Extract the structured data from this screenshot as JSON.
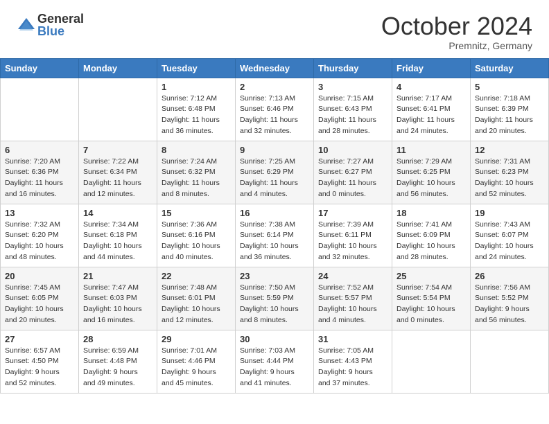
{
  "header": {
    "logo_general": "General",
    "logo_blue": "Blue",
    "month": "October 2024",
    "location": "Premnitz, Germany"
  },
  "days_of_week": [
    "Sunday",
    "Monday",
    "Tuesday",
    "Wednesday",
    "Thursday",
    "Friday",
    "Saturday"
  ],
  "weeks": [
    [
      {
        "day": "",
        "info": ""
      },
      {
        "day": "",
        "info": ""
      },
      {
        "day": "1",
        "info": "Sunrise: 7:12 AM\nSunset: 6:48 PM\nDaylight: 11 hours\nand 36 minutes."
      },
      {
        "day": "2",
        "info": "Sunrise: 7:13 AM\nSunset: 6:46 PM\nDaylight: 11 hours\nand 32 minutes."
      },
      {
        "day": "3",
        "info": "Sunrise: 7:15 AM\nSunset: 6:43 PM\nDaylight: 11 hours\nand 28 minutes."
      },
      {
        "day": "4",
        "info": "Sunrise: 7:17 AM\nSunset: 6:41 PM\nDaylight: 11 hours\nand 24 minutes."
      },
      {
        "day": "5",
        "info": "Sunrise: 7:18 AM\nSunset: 6:39 PM\nDaylight: 11 hours\nand 20 minutes."
      }
    ],
    [
      {
        "day": "6",
        "info": "Sunrise: 7:20 AM\nSunset: 6:36 PM\nDaylight: 11 hours\nand 16 minutes."
      },
      {
        "day": "7",
        "info": "Sunrise: 7:22 AM\nSunset: 6:34 PM\nDaylight: 11 hours\nand 12 minutes."
      },
      {
        "day": "8",
        "info": "Sunrise: 7:24 AM\nSunset: 6:32 PM\nDaylight: 11 hours\nand 8 minutes."
      },
      {
        "day": "9",
        "info": "Sunrise: 7:25 AM\nSunset: 6:29 PM\nDaylight: 11 hours\nand 4 minutes."
      },
      {
        "day": "10",
        "info": "Sunrise: 7:27 AM\nSunset: 6:27 PM\nDaylight: 11 hours\nand 0 minutes."
      },
      {
        "day": "11",
        "info": "Sunrise: 7:29 AM\nSunset: 6:25 PM\nDaylight: 10 hours\nand 56 minutes."
      },
      {
        "day": "12",
        "info": "Sunrise: 7:31 AM\nSunset: 6:23 PM\nDaylight: 10 hours\nand 52 minutes."
      }
    ],
    [
      {
        "day": "13",
        "info": "Sunrise: 7:32 AM\nSunset: 6:20 PM\nDaylight: 10 hours\nand 48 minutes."
      },
      {
        "day": "14",
        "info": "Sunrise: 7:34 AM\nSunset: 6:18 PM\nDaylight: 10 hours\nand 44 minutes."
      },
      {
        "day": "15",
        "info": "Sunrise: 7:36 AM\nSunset: 6:16 PM\nDaylight: 10 hours\nand 40 minutes."
      },
      {
        "day": "16",
        "info": "Sunrise: 7:38 AM\nSunset: 6:14 PM\nDaylight: 10 hours\nand 36 minutes."
      },
      {
        "day": "17",
        "info": "Sunrise: 7:39 AM\nSunset: 6:11 PM\nDaylight: 10 hours\nand 32 minutes."
      },
      {
        "day": "18",
        "info": "Sunrise: 7:41 AM\nSunset: 6:09 PM\nDaylight: 10 hours\nand 28 minutes."
      },
      {
        "day": "19",
        "info": "Sunrise: 7:43 AM\nSunset: 6:07 PM\nDaylight: 10 hours\nand 24 minutes."
      }
    ],
    [
      {
        "day": "20",
        "info": "Sunrise: 7:45 AM\nSunset: 6:05 PM\nDaylight: 10 hours\nand 20 minutes."
      },
      {
        "day": "21",
        "info": "Sunrise: 7:47 AM\nSunset: 6:03 PM\nDaylight: 10 hours\nand 16 minutes."
      },
      {
        "day": "22",
        "info": "Sunrise: 7:48 AM\nSunset: 6:01 PM\nDaylight: 10 hours\nand 12 minutes."
      },
      {
        "day": "23",
        "info": "Sunrise: 7:50 AM\nSunset: 5:59 PM\nDaylight: 10 hours\nand 8 minutes."
      },
      {
        "day": "24",
        "info": "Sunrise: 7:52 AM\nSunset: 5:57 PM\nDaylight: 10 hours\nand 4 minutes."
      },
      {
        "day": "25",
        "info": "Sunrise: 7:54 AM\nSunset: 5:54 PM\nDaylight: 10 hours\nand 0 minutes."
      },
      {
        "day": "26",
        "info": "Sunrise: 7:56 AM\nSunset: 5:52 PM\nDaylight: 9 hours\nand 56 minutes."
      }
    ],
    [
      {
        "day": "27",
        "info": "Sunrise: 6:57 AM\nSunset: 4:50 PM\nDaylight: 9 hours\nand 52 minutes."
      },
      {
        "day": "28",
        "info": "Sunrise: 6:59 AM\nSunset: 4:48 PM\nDaylight: 9 hours\nand 49 minutes."
      },
      {
        "day": "29",
        "info": "Sunrise: 7:01 AM\nSunset: 4:46 PM\nDaylight: 9 hours\nand 45 minutes."
      },
      {
        "day": "30",
        "info": "Sunrise: 7:03 AM\nSunset: 4:44 PM\nDaylight: 9 hours\nand 41 minutes."
      },
      {
        "day": "31",
        "info": "Sunrise: 7:05 AM\nSunset: 4:43 PM\nDaylight: 9 hours\nand 37 minutes."
      },
      {
        "day": "",
        "info": ""
      },
      {
        "day": "",
        "info": ""
      }
    ]
  ]
}
